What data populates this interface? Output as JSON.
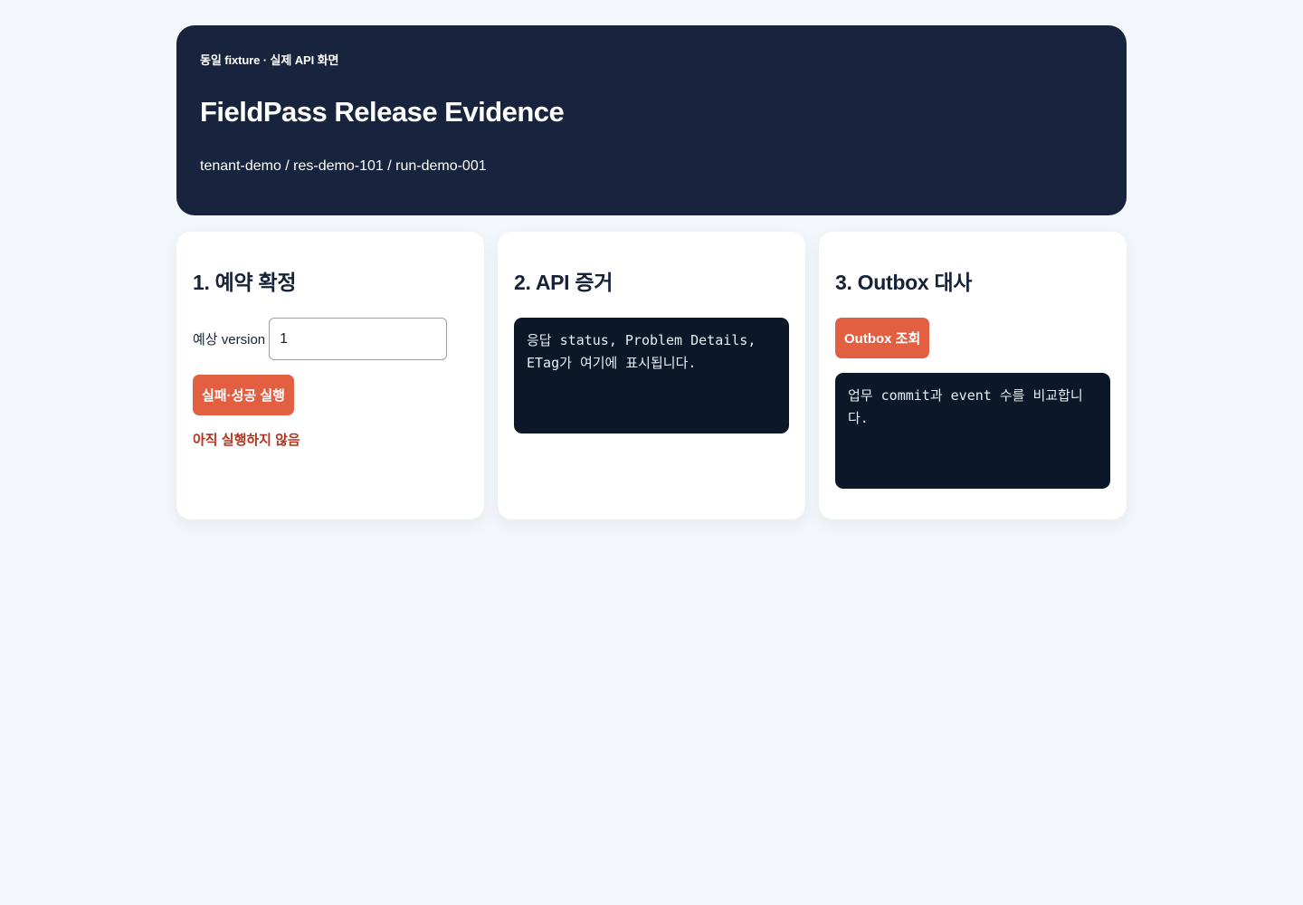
{
  "header": {
    "eyebrow": "동일 fixture · 실제 API 화면",
    "title": "FieldPass Release Evidence",
    "context": "tenant-demo / res-demo-101 / run-demo-001"
  },
  "cards": {
    "reservation": {
      "title": "1. 예약 확정",
      "version_label": "예상 version",
      "version_value": "1",
      "run_button": "실패·성공 실행",
      "status": "아직 실행하지 않음"
    },
    "api": {
      "title": "2. API 증거",
      "output": "응답 status, Problem Details, ETag가 여기에 표시됩니다."
    },
    "outbox": {
      "title": "3. Outbox 대사",
      "query_button": "Outbox 조회",
      "output": "업무 commit과 event 수를 비교합니다."
    }
  },
  "colors": {
    "background": "#f3f7fb",
    "hero": "#18233d",
    "accent": "#e35f41",
    "status": "#b1351f",
    "code": "#0d172a"
  }
}
